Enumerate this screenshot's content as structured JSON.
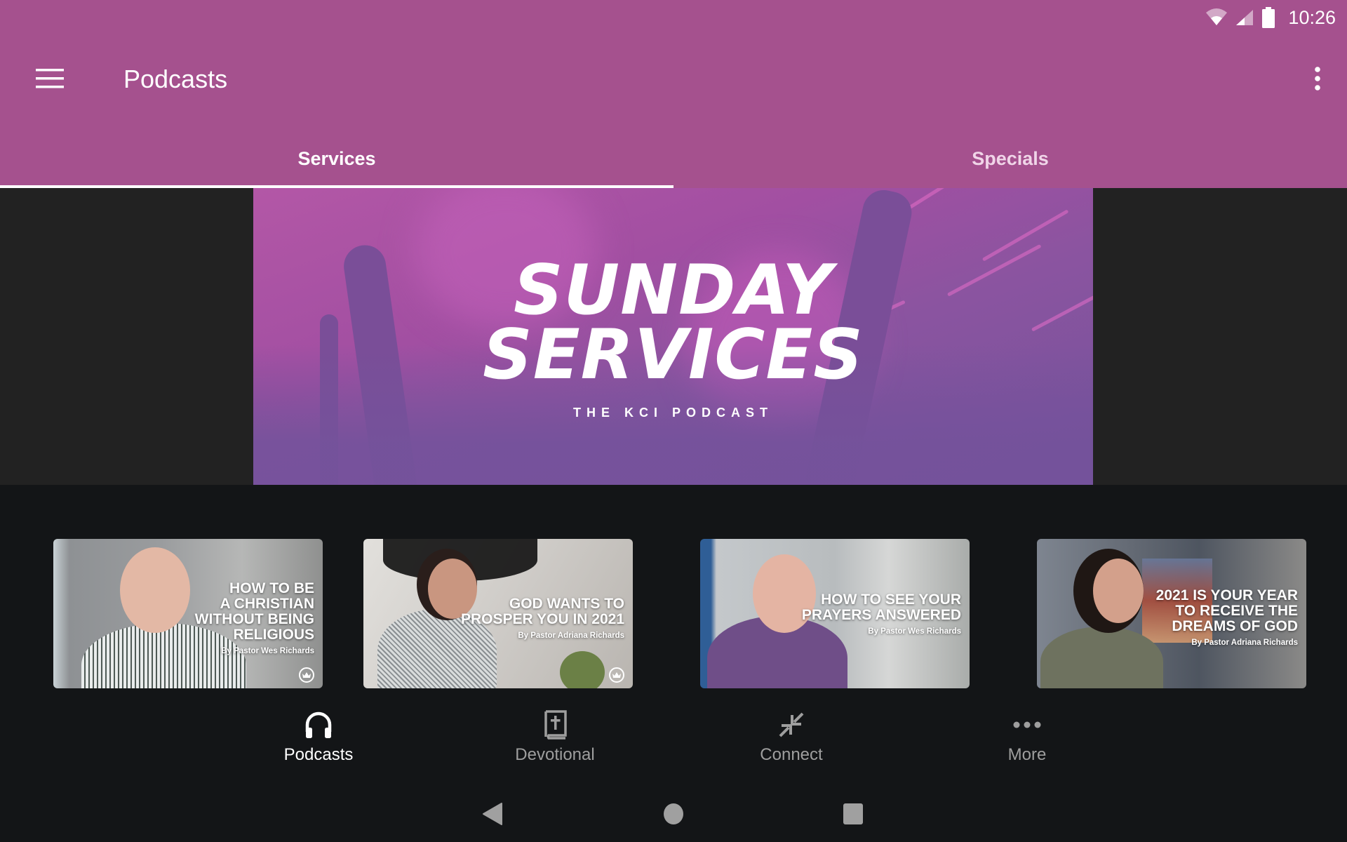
{
  "status_bar": {
    "time": "10:26",
    "icons": [
      "wifi-icon",
      "cellular-signal-icon",
      "battery-icon"
    ]
  },
  "appbar": {
    "title": "Podcasts",
    "menu_icon": "hamburger-menu-icon",
    "overflow_icon": "more-vert-icon"
  },
  "tabs": [
    {
      "label": "Services",
      "active": true
    },
    {
      "label": "Specials",
      "active": false
    }
  ],
  "banner": {
    "title_line1": "SUNDAY",
    "title_line2": "SERVICES",
    "subtitle": "THE KCI PODCAST"
  },
  "episodes": [
    {
      "headline": "HOW TO BE\nA CHRISTIAN\nWITHOUT BEING\nRELIGIOUS",
      "byline": "By Pastor Wes Richards",
      "badge": "crown-icon"
    },
    {
      "headline": "GOD WANTS TO\nPROSPER YOU IN 2021",
      "byline": "By Pastor Adriana Richards",
      "badge": "crown-icon"
    },
    {
      "headline": "HOW TO SEE YOUR\nPRAYERS ANSWERED",
      "byline": "By Pastor Wes Richards",
      "badge": ""
    },
    {
      "headline": "2021 IS YOUR YEAR\nTO RECEIVE THE\nDREAMS OF GOD",
      "byline": "By Pastor Adriana Richards",
      "badge": ""
    }
  ],
  "bottom_nav": [
    {
      "label": "Podcasts",
      "icon": "headphones-icon",
      "active": true
    },
    {
      "label": "Devotional",
      "icon": "bible-icon",
      "active": false
    },
    {
      "label": "Connect",
      "icon": "connect-arrows-icon",
      "active": false
    },
    {
      "label": "More",
      "icon": "more-horiz-icon",
      "active": false
    }
  ],
  "system_nav": [
    "back-icon",
    "home-icon",
    "recents-icon"
  ],
  "colors": {
    "primary": "#a5518e",
    "background": "#131517",
    "banner_gutter": "#222222",
    "active_nav": "#ffffff",
    "inactive_nav": "#9e9e9e"
  }
}
